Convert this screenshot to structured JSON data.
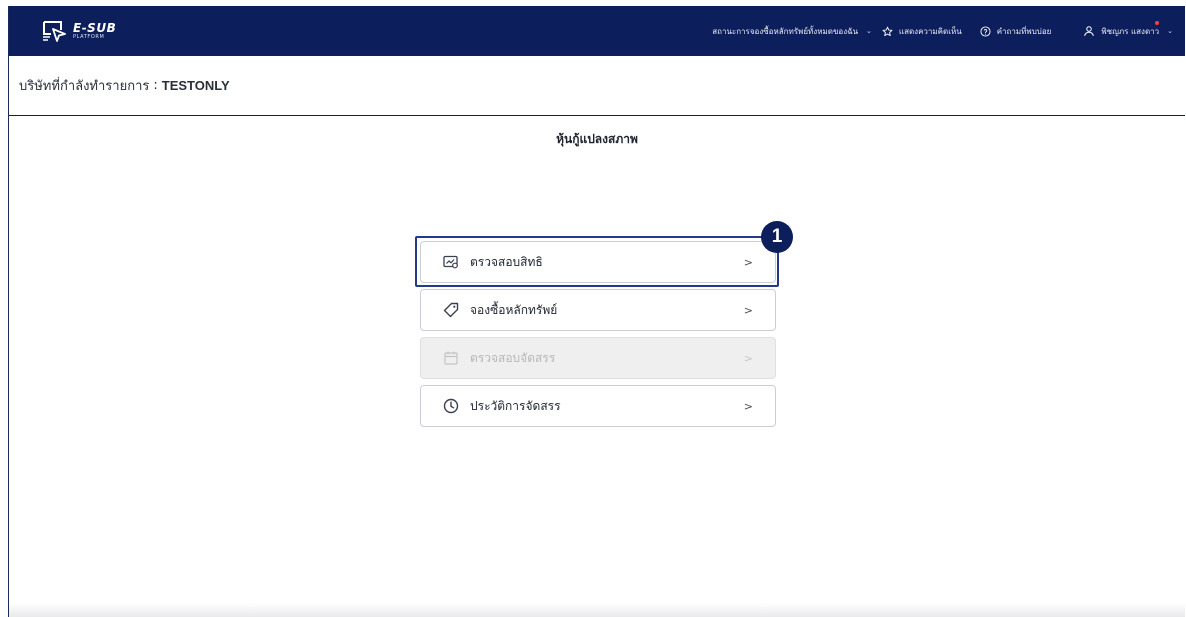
{
  "brand": {
    "name": "E-SUB",
    "tagline": "PLATFORM"
  },
  "nav": {
    "status_label": "สถานะการจองซื้อหลักทรัพย์ทั้งหมดของฉัน",
    "feedback_label": "แสดงความคิดเห็น",
    "faq_label": "คำถามที่พบบ่อย",
    "user_name": "พิชญภร แสงดาว"
  },
  "company": {
    "label": "บริษัทที่กำลังทำรายการ",
    "separator": ":",
    "name": "TESTONLY"
  },
  "section": {
    "title": "หุ้นกู้แปลงสภาพ"
  },
  "menu": {
    "items": [
      {
        "label": "ตรวจสอบสิทธิ",
        "icon": "check-rights-icon",
        "arrow": ">",
        "enabled": true
      },
      {
        "label": "จองซื้อหลักทรัพย์",
        "icon": "tag-icon",
        "arrow": ">",
        "enabled": true
      },
      {
        "label": "ตรวจสอบจัดสรร",
        "icon": "calendar-icon",
        "arrow": ">",
        "enabled": false
      },
      {
        "label": "ประวัติการจัดสรร",
        "icon": "clock-icon",
        "arrow": ">",
        "enabled": true
      }
    ]
  },
  "step_badge": "1",
  "colors": {
    "navy": "#0c1f5c",
    "highlight": "#233a8a",
    "disabled_bg": "#efefef",
    "notif": "#ff3b3b"
  }
}
